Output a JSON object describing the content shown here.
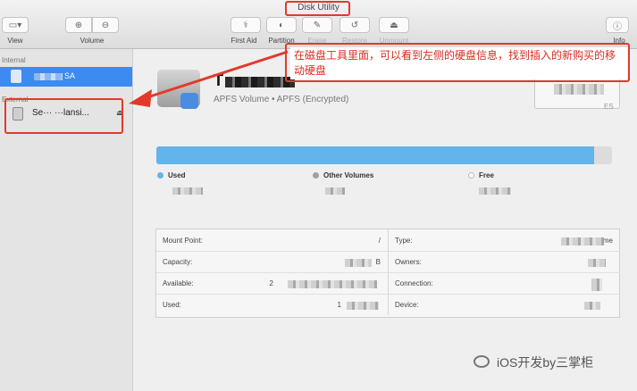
{
  "window": {
    "title": "Disk Utility"
  },
  "toolbar": {
    "view_label": "View",
    "volume_label": "Volume",
    "first_aid_label": "First Aid",
    "partition_label": "Partition",
    "erase_label": "Erase",
    "restore_label": "Restore",
    "unmount_label": "Unmount",
    "info_label": "Info"
  },
  "sidebar": {
    "internal_label": "Internal",
    "internal_item": "SA",
    "external_label": "External",
    "external_item": "Se··· ···lansi..."
  },
  "volume": {
    "name": "T",
    "subtitle": "APFS Volume • APFS (Encrypted)",
    "size_suffix": "ES"
  },
  "usage": {
    "used_fraction": 0.96,
    "legend": [
      {
        "label": "Used",
        "color": "#63b4e9"
      },
      {
        "label": "Other Volumes",
        "color": "#a0a0a0"
      },
      {
        "label": "Free",
        "color": "#ffffff"
      }
    ]
  },
  "info": {
    "left": [
      {
        "key": "Mount Point:",
        "value": "/"
      },
      {
        "key": "Capacity:",
        "value": "B"
      },
      {
        "key": "Available:",
        "value": "2"
      },
      {
        "key": "Used:",
        "value": "1"
      }
    ],
    "right": [
      {
        "key": "Type:",
        "value": "me"
      },
      {
        "key": "Owners:",
        "value": ""
      },
      {
        "key": "Connection:",
        "value": ""
      },
      {
        "key": "Device:",
        "value": ""
      }
    ]
  },
  "annotation": {
    "text": "在磁盘工具里面，可以看到左侧的硬盘信息，找到插入的新购买的移动硬盘",
    "color": "#d92b1e"
  },
  "watermark": {
    "text": "iOS开发by三掌柜"
  }
}
